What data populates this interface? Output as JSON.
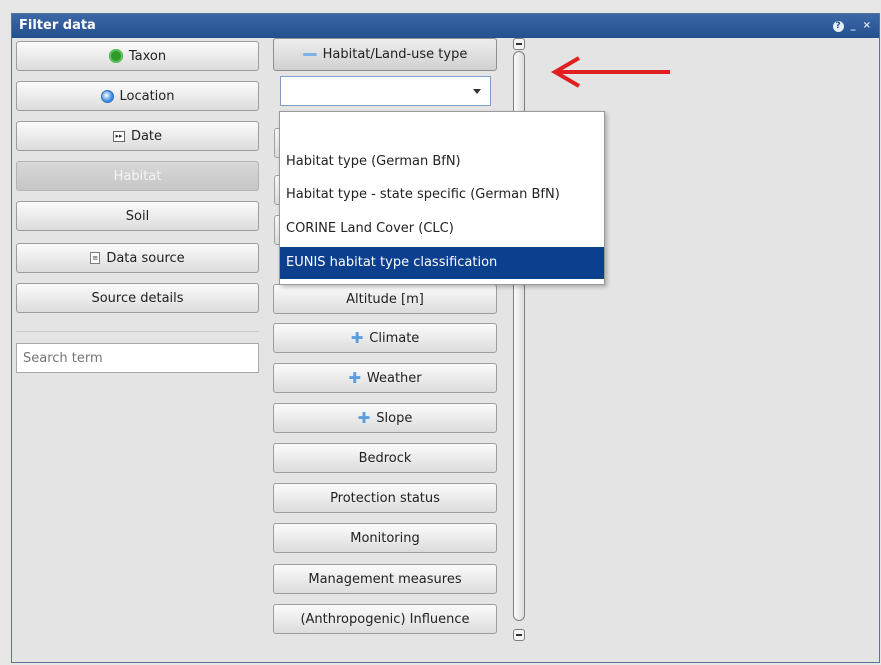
{
  "window": {
    "title": "Filter data",
    "tools": {
      "help": "?",
      "minimize": "_",
      "close": "×"
    }
  },
  "left_panel": {
    "buttons": [
      {
        "label": "Taxon",
        "icon": "gear-icon"
      },
      {
        "label": "Location",
        "icon": "globe-icon"
      },
      {
        "label": "Date",
        "icon": "calendar-icon"
      },
      {
        "label": "Habitat",
        "icon": "",
        "state": "disabled"
      },
      {
        "label": "Soil",
        "icon": ""
      },
      {
        "label": "Data source",
        "icon": "document-icon"
      },
      {
        "label": "Source details",
        "icon": ""
      }
    ],
    "search": {
      "placeholder": "Search term",
      "value": ""
    }
  },
  "middle_panel": {
    "header_button": {
      "label": "Habitat/Land-use type",
      "icon": "collapse-dash-icon"
    },
    "combo": {
      "value": ""
    },
    "dropdown": {
      "options": [
        "",
        "Habitat type (German BfN)",
        "Habitat type - state specific (German BfN)",
        "CORINE Land Cover (CLC)",
        "EUNIS habitat type classification"
      ],
      "selected_index": 4
    },
    "buttons": [
      {
        "label": "Altitude [m]",
        "icon": ""
      },
      {
        "label": "Climate",
        "icon": "expand-plus-icon"
      },
      {
        "label": "Weather",
        "icon": "expand-plus-icon"
      },
      {
        "label": "Slope",
        "icon": "expand-plus-icon"
      },
      {
        "label": "Bedrock",
        "icon": ""
      },
      {
        "label": "Protection status",
        "icon": ""
      },
      {
        "label": "Monitoring",
        "icon": ""
      },
      {
        "label": "Management measures",
        "icon": ""
      },
      {
        "label": "(Anthropogenic) Influence",
        "icon": ""
      }
    ]
  },
  "annotation": {
    "arrow_color": "#e02020"
  },
  "colors": {
    "title_bar": "#2b5797",
    "selected_option": "#0c3f8e"
  }
}
